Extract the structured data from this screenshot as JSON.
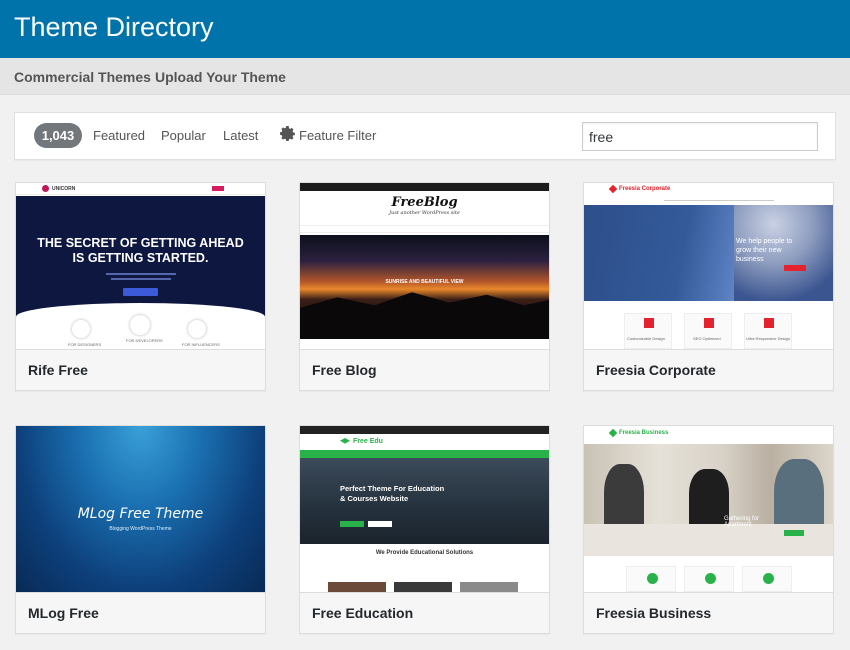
{
  "header": {
    "title": "Theme Directory"
  },
  "subnav": {
    "items": [
      "Commercial Themes",
      "Upload Your Theme"
    ]
  },
  "filters": {
    "count": "1,043",
    "tabs": [
      "Featured",
      "Popular",
      "Latest"
    ],
    "feature_filter": "Feature Filter",
    "search_value": "free"
  },
  "themes": [
    {
      "name": "Rife Free",
      "preview": {
        "logo": "UNICORN",
        "headline1": "THE SECRET OF GETTING AHEAD",
        "headline2": "IS GETTING STARTED.",
        "features": [
          "FOR DESIGNERS",
          "FOR DEVELOPERS",
          "FOR INFLUENCERS"
        ]
      }
    },
    {
      "name": "Free Blog",
      "preview": {
        "logo": "FreeBlog",
        "tagline": "Just another WordPress site",
        "caption": "SUNRISE AND BEAUTIFUL VIEW"
      }
    },
    {
      "name": "Freesia Corporate",
      "preview": {
        "logo": "Freesia Corporate",
        "hero": "We help people to grow their new business",
        "services": [
          "Customizable Design",
          "SEO Optimized",
          "Ultra Responsive Design"
        ]
      }
    },
    {
      "name": "MLog Free",
      "preview": {
        "title": "MLog Free Theme",
        "subtitle": "Blogging WordPress Theme"
      }
    },
    {
      "name": "Free Education",
      "preview": {
        "logo": "Free Edu",
        "hero1": "Perfect Theme For Education",
        "hero2": "& Courses Website",
        "section": "We Provide Educational Solutions"
      }
    },
    {
      "name": "Freesia Business",
      "preview": {
        "logo": "Freesia Business",
        "hero": "Gathering for Apartment"
      }
    }
  ],
  "colors": {
    "header": "#0073aa",
    "accent": "#e5232e",
    "green": "#2ab24a"
  }
}
